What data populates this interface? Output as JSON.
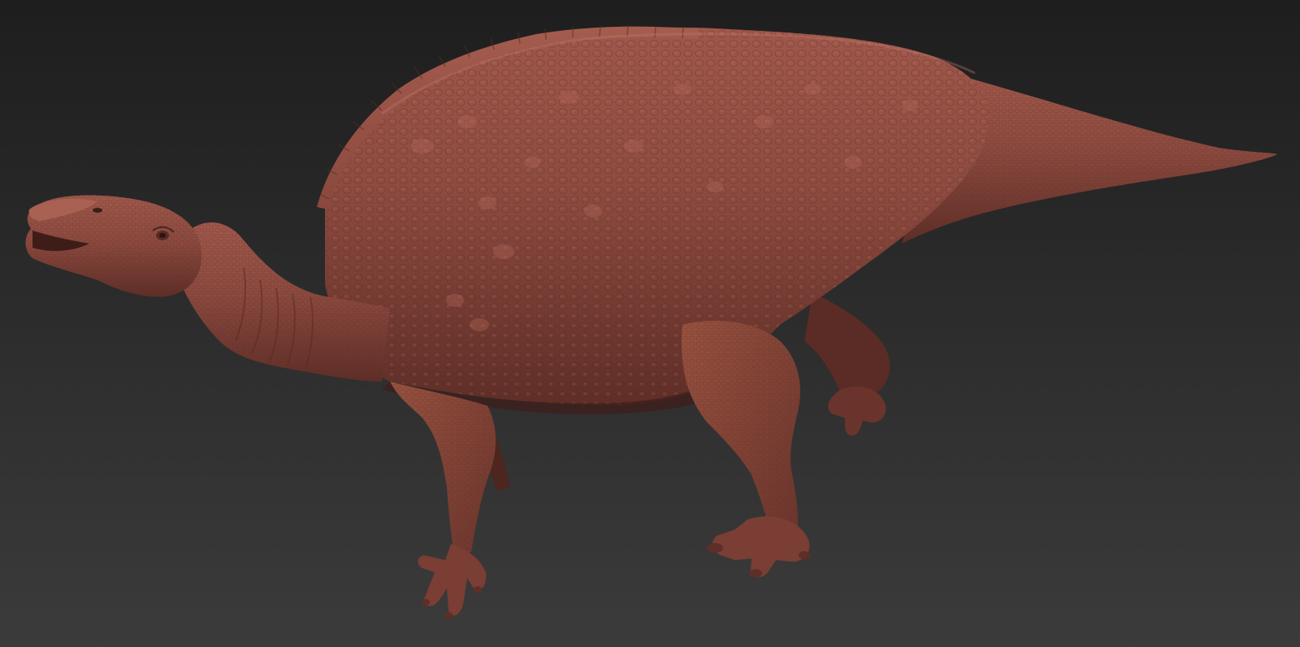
{
  "scene": {
    "subject": "dinosaur-sculpt",
    "background_colors": {
      "top": "#1e1e1e",
      "bottom": "#3b3b3b"
    },
    "material_colors": {
      "base": "#86463c",
      "light": "#a0584b",
      "highlight": "#b46a5c",
      "dark": "#5e2e27",
      "shadow": "#3e1d19"
    }
  }
}
